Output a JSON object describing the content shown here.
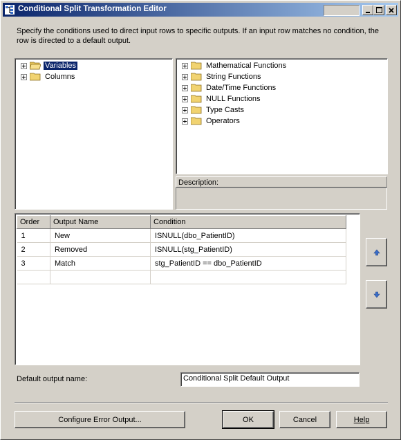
{
  "window": {
    "title": "Conditional Split Transformation Editor"
  },
  "instructions": "Specify the conditions used to direct input rows to specific outputs. If an input row matches no condition, the row is directed to a default output.",
  "left_tree": [
    {
      "label": "Variables",
      "selected": true,
      "open": true
    },
    {
      "label": "Columns",
      "selected": false,
      "open": false
    }
  ],
  "right_tree": [
    {
      "label": "Mathematical Functions"
    },
    {
      "label": "String Functions"
    },
    {
      "label": "Date/Time Functions"
    },
    {
      "label": "NULL Functions"
    },
    {
      "label": "Type Casts"
    },
    {
      "label": "Operators"
    }
  ],
  "description": {
    "header": "Description:"
  },
  "grid": {
    "columns": [
      "Order",
      "Output Name",
      "Condition"
    ],
    "rows": [
      {
        "order": "1",
        "name": "New",
        "condition": "ISNULL(dbo_PatientID)"
      },
      {
        "order": "2",
        "name": "Removed",
        "condition": "ISNULL(stg_PatientID)"
      },
      {
        "order": "3",
        "name": "Match",
        "condition": "stg_PatientID == dbo_PatientID"
      }
    ]
  },
  "default_output": {
    "label": "Default output name:",
    "value": "Conditional Split Default Output"
  },
  "buttons": {
    "configure": "Configure Error Output...",
    "ok": "OK",
    "cancel": "Cancel",
    "help": "Help"
  },
  "icons": {
    "move_up": "arrow-up-icon",
    "move_down": "arrow-down-icon",
    "folder": "folder-icon",
    "expand": "plus-expand-icon"
  },
  "colors": {
    "title_start": "#0a246a",
    "title_end": "#a6caf0",
    "selection": "#0a246a",
    "face": "#d4d0c8",
    "arrow": "#3a6ec8"
  }
}
